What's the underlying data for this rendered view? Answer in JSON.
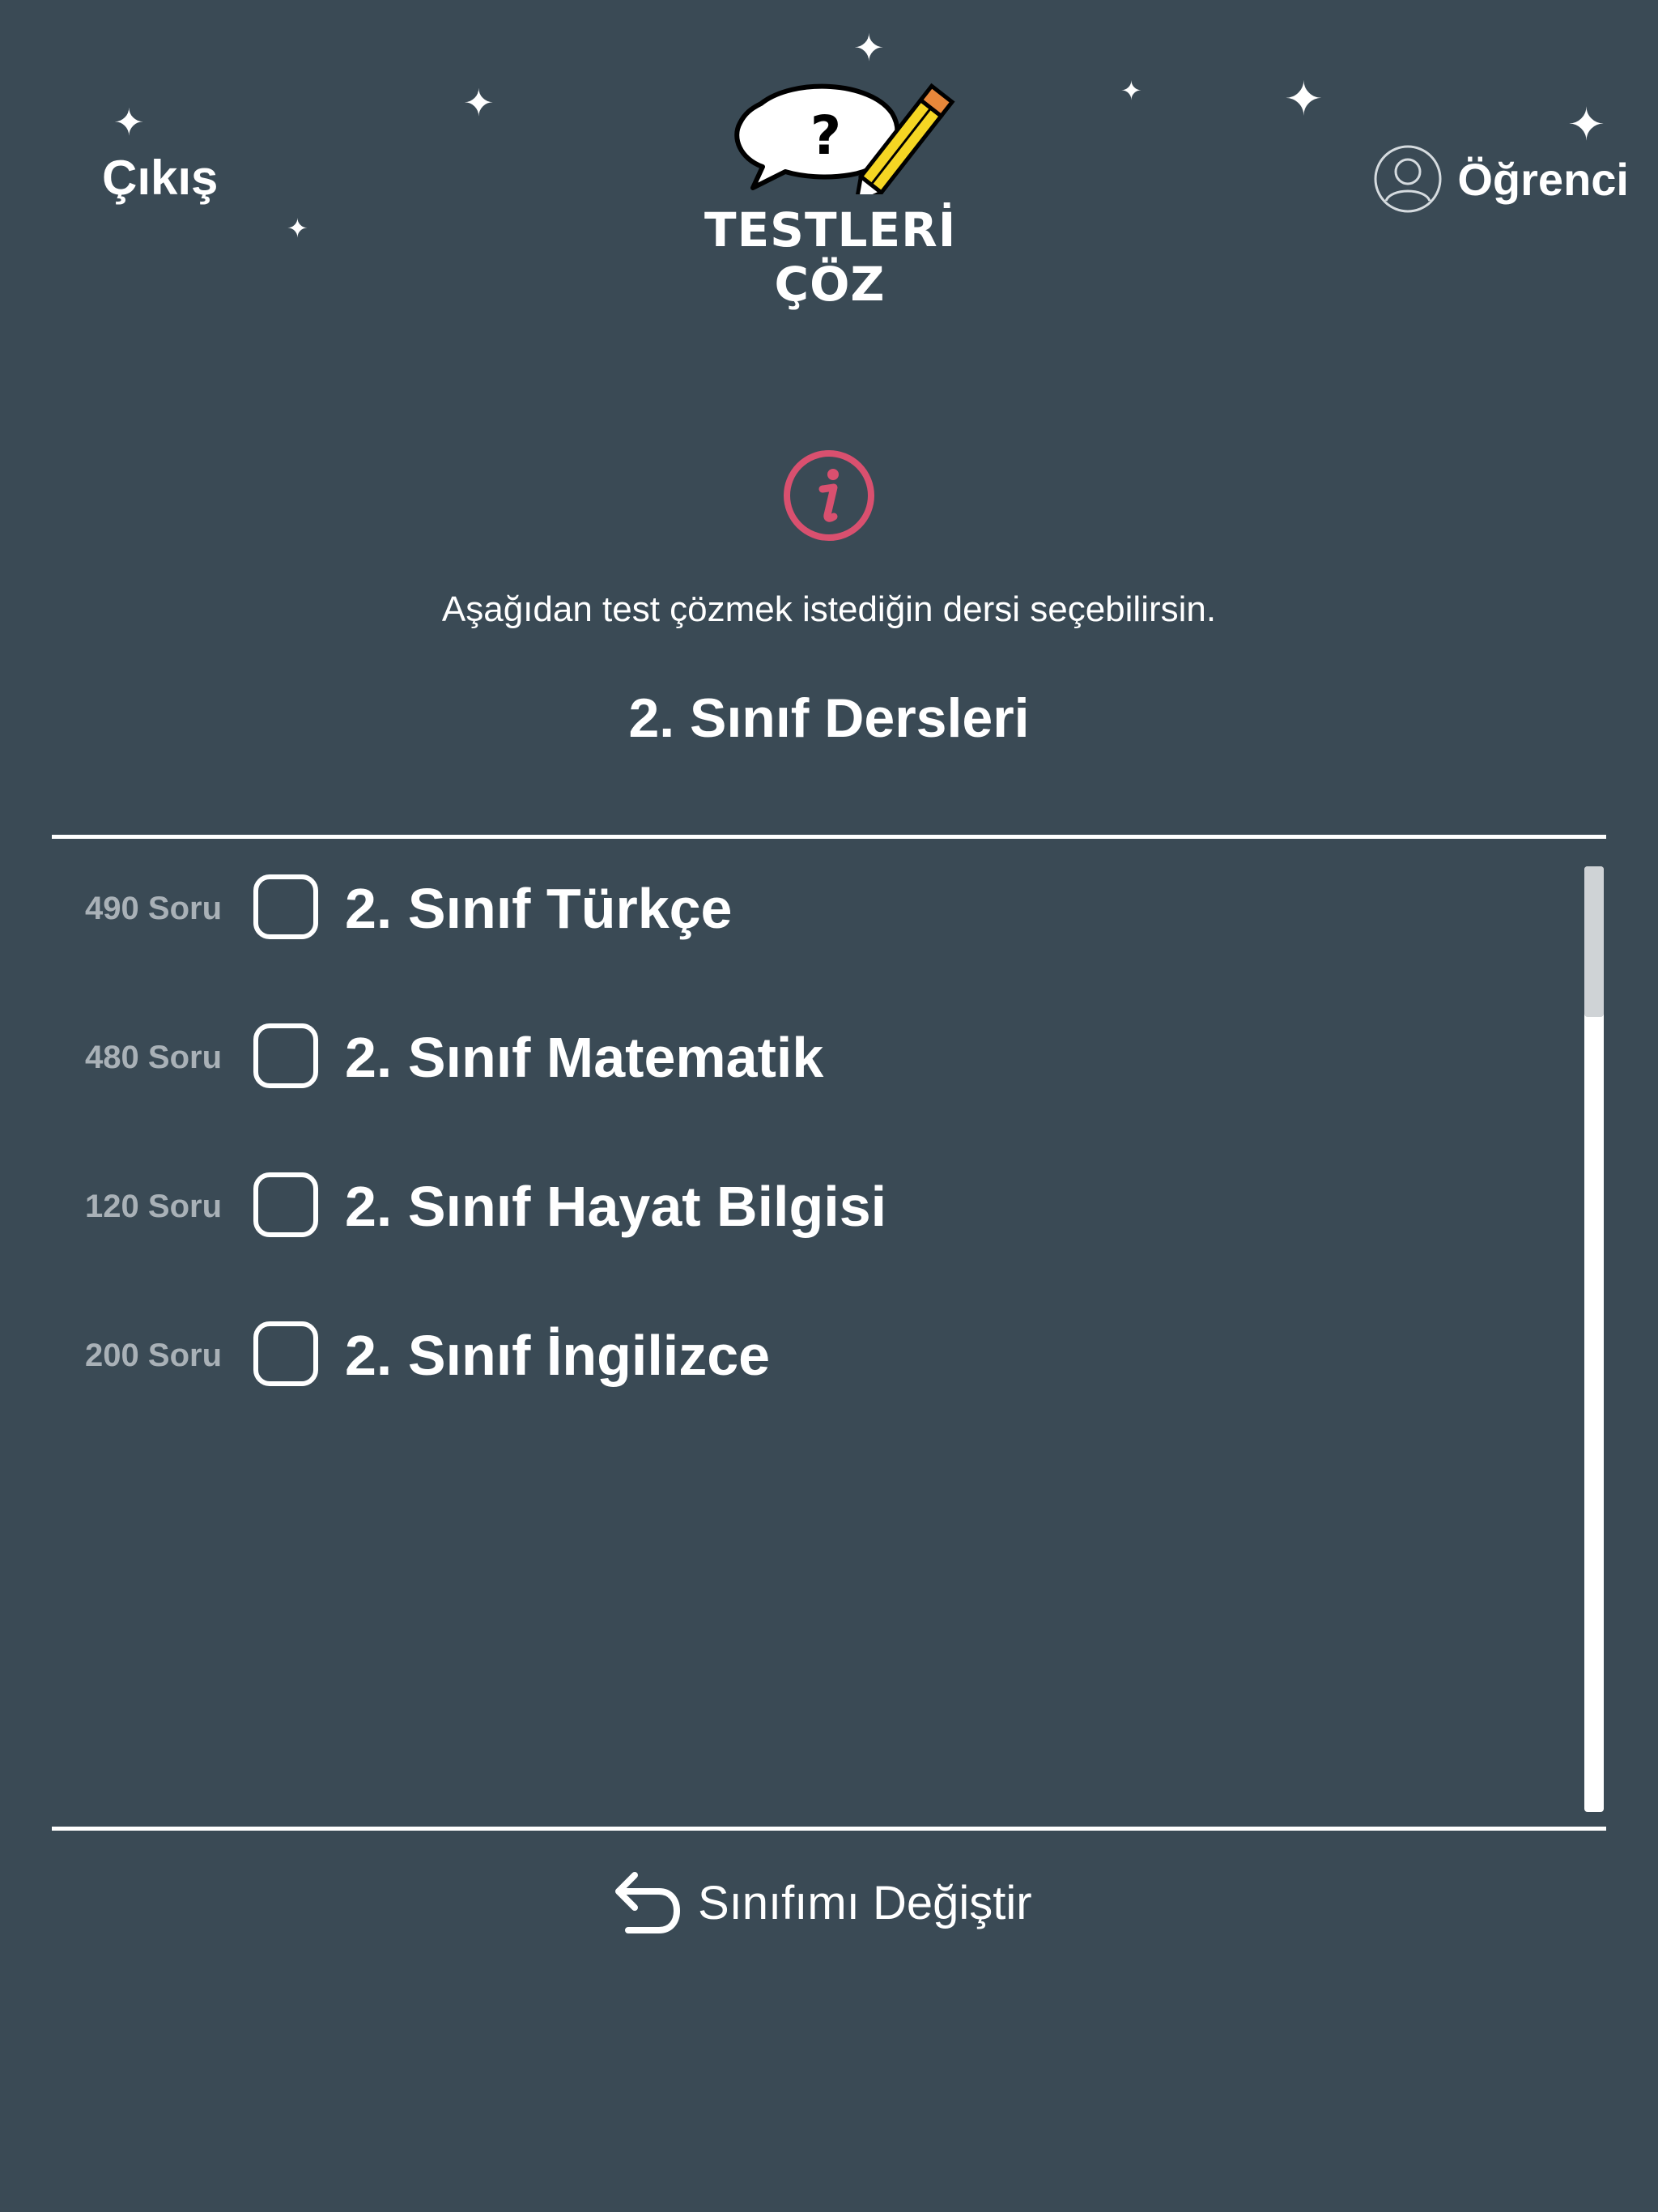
{
  "header": {
    "exit_label": "Çıkış",
    "user_label": "Öğrenci",
    "logo": {
      "line1": "TESTLERİ",
      "line2": "ÇÖZ"
    }
  },
  "main": {
    "instruction": "Aşağıdan test çözmek istediğin dersi seçebilirsin.",
    "title": "2. Sınıf Dersleri",
    "subjects": [
      {
        "count": "490 Soru",
        "name": "2. Sınıf Türkçe",
        "checked": false
      },
      {
        "count": "480 Soru",
        "name": "2. Sınıf Matematik",
        "checked": false
      },
      {
        "count": "120 Soru",
        "name": "2. Sınıf Hayat Bilgisi",
        "checked": false
      },
      {
        "count": "200 Soru",
        "name": "2. Sınıf İngilizce",
        "checked": false
      }
    ]
  },
  "footer": {
    "change_class_label": "Sınıfımı Değiştir"
  },
  "icons": {
    "info": "info-icon",
    "user": "user-icon",
    "back": "undo-arrow-icon",
    "sparkle": "sparkle-icon"
  },
  "colors": {
    "background": "#3a4a55",
    "accent": "#d9506f",
    "text": "#ffffff",
    "muted": "#a9b1b7",
    "pencil": "#f5d623"
  }
}
